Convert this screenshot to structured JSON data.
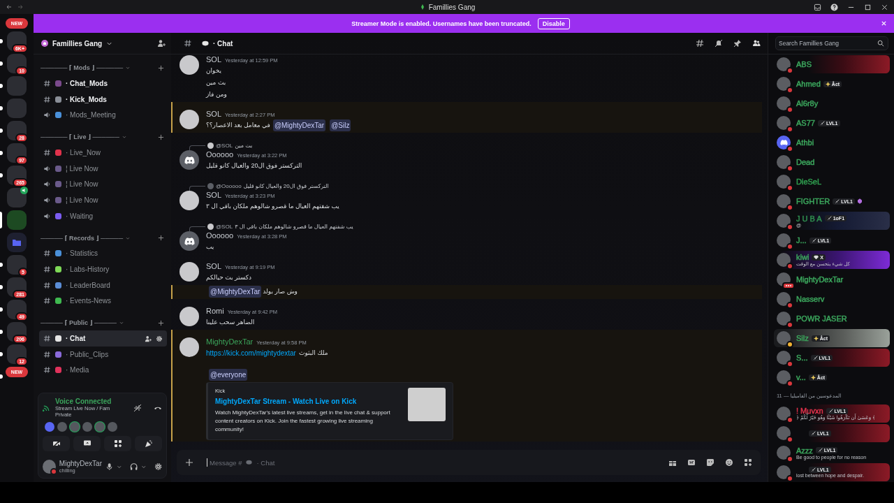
{
  "window": {
    "title": "Famillies Gang"
  },
  "banner": {
    "text": "Streamer Mode is enabled. Usernames have been truncated.",
    "button": "Disable"
  },
  "servers": [
    {
      "kind": "new",
      "text": "NEW",
      "unread": false,
      "selected": false
    },
    {
      "kind": "server",
      "badge": "6K+",
      "unread": true,
      "selected": false
    },
    {
      "kind": "server",
      "badge": "10",
      "unread": true,
      "selected": false
    },
    {
      "kind": "server",
      "unread": true,
      "selected": false
    },
    {
      "kind": "server",
      "unread": true,
      "selected": false
    },
    {
      "kind": "server",
      "badge": "28",
      "unread": true,
      "selected": false
    },
    {
      "kind": "server",
      "badge": "97",
      "unread": true,
      "selected": false
    },
    {
      "kind": "server",
      "badge": "265",
      "unread": true,
      "selected": false
    },
    {
      "kind": "voice",
      "unread": false,
      "selected": false
    },
    {
      "kind": "server",
      "unread": false,
      "selected": true
    },
    {
      "kind": "folder",
      "unread": false,
      "selected": false
    },
    {
      "kind": "server",
      "badge": "5",
      "unread": true,
      "selected": false
    },
    {
      "kind": "server",
      "badge": "281",
      "unread": true,
      "selected": false
    },
    {
      "kind": "server",
      "badge": "49",
      "unread": true,
      "selected": false
    },
    {
      "kind": "server",
      "badge": "206",
      "unread": true,
      "selected": false
    },
    {
      "kind": "server",
      "badge": "12",
      "unread": true,
      "selected": false
    },
    {
      "kind": "new",
      "text": "NEW",
      "unread": true,
      "selected": false
    }
  ],
  "server_name": "Famillies Gang",
  "categories": [
    {
      "label": "────── ⌈ Mods ⌋ ──────",
      "items": [
        {
          "kind": "text",
          "color": "#7a4a8c",
          "name": "· Chat_Mods",
          "unread": true,
          "selected": false
        },
        {
          "kind": "text",
          "color": "#8a8f98",
          "name": "· Kick_Mods",
          "unread": true,
          "selected": false
        },
        {
          "kind": "voice",
          "color": "#4a90d9",
          "name": "· Mods_Meeting",
          "unread": false,
          "selected": false
        }
      ]
    },
    {
      "label": "────── ⌈ Live ⌋ ──────",
      "items": [
        {
          "kind": "text",
          "color": "#e0324b",
          "name": "· Live_Now",
          "unread": false,
          "selected": false
        },
        {
          "kind": "voice",
          "color": "#6a5a8a",
          "name": "¦ Live Now",
          "unread": false,
          "selected": false
        },
        {
          "kind": "voice",
          "color": "#6a5a8a",
          "name": "¦ Live Now",
          "unread": false,
          "selected": false
        },
        {
          "kind": "voice",
          "color": "#6a5a8a",
          "name": "¦ Live Now",
          "unread": false,
          "selected": false
        },
        {
          "kind": "voice",
          "color": "#7b5cf0",
          "name": "· Waiting",
          "unread": false,
          "selected": false
        }
      ]
    },
    {
      "label": "───── ⌈ Records ⌋ ─────",
      "items": [
        {
          "kind": "text",
          "color": "#4a90d9",
          "name": "· Statistics",
          "unread": false,
          "selected": false
        },
        {
          "kind": "text",
          "color": "#7ed957",
          "name": "· Labs-History",
          "unread": false,
          "selected": false
        },
        {
          "kind": "text",
          "color": "#5b8dd6",
          "name": "· LeaderBoard",
          "unread": false,
          "selected": false
        },
        {
          "kind": "text",
          "color": "#3fb950",
          "name": "· Events-News",
          "unread": false,
          "selected": false
        }
      ]
    },
    {
      "label": "───── ⌈ Public ⌋ ─────",
      "items": [
        {
          "kind": "text",
          "color": "#e6e6e6",
          "name": "· Chat",
          "unread": false,
          "selected": true
        },
        {
          "kind": "text",
          "color": "#8a6ad9",
          "name": "· Public_Clips",
          "unread": false,
          "selected": false
        },
        {
          "kind": "text",
          "color": "#e0325b",
          "name": "· Media",
          "unread": false,
          "selected": false
        }
      ]
    }
  ],
  "voice": {
    "status": "Voice Connected",
    "channel": "Stream Live Now / Fam Private"
  },
  "user": {
    "name": "MightyDexTar",
    "status": "chilling"
  },
  "channel": {
    "name": "· Chat"
  },
  "search": {
    "placeholder": "Search Famillies Gang"
  },
  "messages": [
    {
      "author": "SOL",
      "color": "#c9cdd3",
      "time": "Yesterday at 12:59 PM",
      "default_avatar": false,
      "highlighted": false,
      "lines": [
        [
          {
            "kind": "text",
            "text": "يخوان"
          }
        ],
        [
          {
            "kind": "text",
            "text": "بث مين"
          }
        ],
        [
          {
            "kind": "text",
            "text": "ومن فاز"
          }
        ]
      ]
    },
    {
      "author": "SOL",
      "color": "#c9cdd3",
      "time": "Yesterday at 2:27 PM",
      "default_avatar": false,
      "highlighted": true,
      "lines": [
        [
          {
            "kind": "text",
            "text": "في معامل بعد الاعصار؟؟"
          },
          {
            "kind": "mention",
            "text": "@MightyDexTar"
          },
          {
            "kind": "mention",
            "text": "@Silz"
          }
        ]
      ]
    },
    {
      "reply": {
        "author": "@SOL",
        "text": "بث مين",
        "default_avatar": false
      },
      "author": "Oooooo",
      "color": "#c9cdd3",
      "time": "Yesterday at 3:22 PM",
      "default_avatar": true,
      "highlighted": false,
      "lines": [
        [
          {
            "kind": "text",
            "text": "التركستر فوق ال20 والعيال كانو قليل"
          }
        ]
      ]
    },
    {
      "reply": {
        "author": "@Oooooo",
        "text": "التركستر فوق ال20 والعيال كانو قليل",
        "default_avatar": true
      },
      "author": "SOL",
      "color": "#c9cdd3",
      "time": "Yesterday at 3:23 PM",
      "default_avatar": false,
      "highlighted": false,
      "lines": [
        [
          {
            "kind": "text",
            "text": "يب شفتهم العيال ما قصرو شالوهم ملكان باقي ال ٣"
          }
        ]
      ]
    },
    {
      "reply": {
        "author": "@SOL",
        "text": "يب شفتهم العيال ما قصرو شالوهم ملكان باقي ال ٣",
        "default_avatar": false
      },
      "author": "Oooooo",
      "color": "#c9cdd3",
      "time": "Yesterday at 3:28 PM",
      "default_avatar": true,
      "highlighted": false,
      "lines": [
        [
          {
            "kind": "text",
            "text": "يب"
          }
        ]
      ]
    },
    {
      "author": "SOL",
      "color": "#c9cdd3",
      "time": "Yesterday at 9:19 PM",
      "default_avatar": false,
      "highlighted": false,
      "lines": [
        [
          {
            "kind": "text",
            "text": "دكستر بث حيالكم"
          }
        ]
      ]
    },
    {
      "highlighted": true,
      "lines": [
        [
          {
            "kind": "mention",
            "text": "@MightyDexTar"
          },
          {
            "kind": "text",
            "text": "وش صار بولد"
          }
        ]
      ]
    },
    {
      "author": "Romi",
      "color": "#c9cdd3",
      "time": "Yesterday at 9:42 PM",
      "default_avatar": false,
      "highlighted": false,
      "lines": [
        [
          {
            "kind": "text",
            "text": "الضاهر سحب علينا"
          }
        ]
      ]
    },
    {
      "author": "MightyDexTar",
      "color": "#3ba55c",
      "time": "Yesterday at 9:58 PM",
      "default_avatar": false,
      "highlighted": true,
      "lines": [
        [
          {
            "kind": "link",
            "text": "https://kick.com/mightydextar"
          },
          {
            "kind": "text",
            "text": "ملك البثوث"
          }
        ],
        [
          {
            "kind": "mention",
            "text": "@everyone"
          }
        ]
      ],
      "embed": {
        "provider": "Kick",
        "title": "MightyDexTar Stream - Watch Live on Kick",
        "description": "Watch MightyDexTar's latest live streams, get in the live chat & support content creators on Kick. Join the fastest growing live streaming community!"
      }
    }
  ],
  "composer": {
    "placeholder_start": "Message #",
    "placeholder_end": "· Chat"
  },
  "members": [
    {
      "name": "ABS",
      "color": "#3ba55c",
      "kind": "crimson",
      "default_avatar": false,
      "idle": false,
      "typing": false
    },
    {
      "name": "Ahmed",
      "color": "#3ba55c",
      "kind": "plain",
      "default_avatar": false,
      "idle": false,
      "typing": false,
      "badge": {
        "kind": "star",
        "text": "Åct"
      }
    },
    {
      "name": "Al6r8y",
      "color": "#3ba55c",
      "kind": "plain",
      "default_avatar": false,
      "idle": false,
      "typing": false
    },
    {
      "name": "AS77",
      "color": "#3ba55c",
      "kind": "plain",
      "default_avatar": false,
      "idle": false,
      "typing": false,
      "badge": {
        "kind": "sword",
        "text": "LVL1"
      }
    },
    {
      "name": "Athbi",
      "color": "#3ba55c",
      "kind": "plain",
      "default_avatar": true,
      "idle": false,
      "typing": false
    },
    {
      "name": "Dead",
      "color": "#3ba55c",
      "kind": "plain",
      "default_avatar": false,
      "idle": false,
      "typing": false
    },
    {
      "name": "DieSeL",
      "color": "#2f9e4f",
      "kind": "plain",
      "default_avatar": false,
      "idle": false,
      "typing": false
    },
    {
      "name": "FIGHTER",
      "color": "#3ba55c",
      "kind": "plain",
      "default_avatar": false,
      "idle": false,
      "typing": false,
      "badge": {
        "kind": "sword",
        "text": "LVL1"
      },
      "boosting": true
    },
    {
      "name": "J U B A",
      "color": "#2f8f4f",
      "kind": "web",
      "default_avatar": false,
      "idle": false,
      "typing": false,
      "badge": {
        "kind": "sword",
        "text": "1oF1"
      },
      "subtext": "@"
    },
    {
      "name": "J...",
      "color": "#3ba55c",
      "kind": "plain",
      "default_avatar": false,
      "idle": false,
      "typing": false,
      "badge": {
        "kind": "sword",
        "text": "LVL1"
      }
    },
    {
      "name": "kiwi",
      "color": "#3ba55c",
      "kind": "violet",
      "default_avatar": false,
      "idle": false,
      "typing": false,
      "badge": {
        "kind": "gem",
        "text": "X"
      },
      "subtext": "كل شيء يتحسن مع الوقت"
    },
    {
      "name": "MightyDexTar",
      "color": "#3ba55c",
      "kind": "plain",
      "default_avatar": false,
      "idle": false,
      "typing": true
    },
    {
      "name": "Nasserv",
      "color": "#3ba55c",
      "kind": "plain",
      "default_avatar": false,
      "idle": false,
      "typing": false
    },
    {
      "name": "POWR JASER",
      "color": "#3ba55c",
      "kind": "plain",
      "default_avatar": false,
      "idle": false,
      "typing": false
    },
    {
      "name": "Silz",
      "color": "#3ba55c",
      "kind": "smoke",
      "default_avatar": false,
      "idle": true,
      "typing": false,
      "badge": {
        "kind": "star",
        "text": "Åct"
      }
    },
    {
      "name": "S...",
      "color": "#3ba55c",
      "kind": "crimson",
      "default_avatar": false,
      "idle": false,
      "typing": false,
      "badge": {
        "kind": "sword",
        "text": "LVL1"
      }
    },
    {
      "name": "v...",
      "color": "#3ba55c",
      "kind": "plain",
      "default_avatar": false,
      "idle": false,
      "typing": false,
      "badge": {
        "kind": "star",
        "text": "Åct"
      }
    }
  ],
  "members_group": {
    "label": "المدعوسين من الفاميليا — 11"
  },
  "members_2": [
    {
      "name": "! Muvxn",
      "color": "#e0324b",
      "kind": "crimson",
      "default_avatar": false,
      "idle": false,
      "typing": false,
      "badge": {
        "kind": "sword",
        "text": "LVL1"
      },
      "subtext": "﴿ وَعَسَىٰ أَن تَكْرَهُوا شَيْئًا وَهُوَ خَيْرٌ لَّكُمْ ﴾"
    },
    {
      "kind": "crimson",
      "default_avatar": false,
      "idle": false,
      "typing": false,
      "badge": {
        "kind": "sword",
        "text": "LVL1"
      }
    },
    {
      "name": "Azzz",
      "color": "#3ba55c",
      "kind": "plain",
      "default_avatar": false,
      "idle": false,
      "typing": false,
      "badge": {
        "kind": "sword",
        "text": "LVL1"
      },
      "subtext": "Be good to people for no reason"
    },
    {
      "kind": "crimson",
      "default_avatar": false,
      "idle": false,
      "typing": false,
      "badge": {
        "kind": "sword",
        "text": "LVL1"
      },
      "subtext": "lost between hope and despair."
    }
  ]
}
